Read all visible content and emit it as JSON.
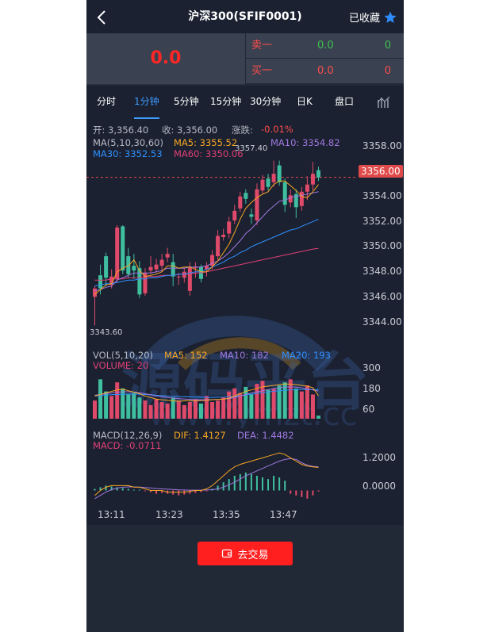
{
  "header": {
    "title": "沪深300(SFIF0001)",
    "favorite_label": "已收藏"
  },
  "quote": {
    "price": "0.0",
    "sell": {
      "label": "卖一",
      "price": "0.0",
      "qty": "0"
    },
    "buy": {
      "label": "买一",
      "price": "0.0",
      "qty": "0"
    }
  },
  "tabs": [
    "分时",
    "1分钟",
    "5分钟",
    "15分钟",
    "30分钟",
    "日K",
    "盘口"
  ],
  "active_tab": "1分钟",
  "stats": {
    "open": "开: 3,356.40",
    "close": "收: 3,356.00",
    "change_label": "涨跌:",
    "change_value": "-0.01%"
  },
  "ma_legend": {
    "params": "MA(5,10,30,60)",
    "ma5": "MA5: 3355.52",
    "ma10": "MA10: 3354.82",
    "ma30": "MA30: 3352.53",
    "ma60": "MA60: 3350.06"
  },
  "vol_legend": {
    "params": "VOL(5,10,20)",
    "ma5": "MA5: 152",
    "ma10": "MA10: 182",
    "ma20": "MA20: 193",
    "volume": "VOLUME: 20"
  },
  "macd_legend": {
    "params": "MACD(12,26,9)",
    "dif": "DIF: 1.4127",
    "dea": "DEA: 1.4482",
    "macd": "MACD: -0.0711"
  },
  "annotations": {
    "high": "3357.40",
    "low": "3343.60",
    "last": "3356.00"
  },
  "watermark": {
    "text": "源码平台",
    "url": "www.ymzt.cc"
  },
  "trade_button": "去交易",
  "colors": {
    "up": "#e04a6a",
    "down": "#3fbfa0",
    "accent": "#3d9bff",
    "price_red": "#ff2626",
    "ma5": "#f5a623",
    "ma10": "#a078e0",
    "ma30": "#2f90ff",
    "ma60": "#e04076"
  },
  "chart_data": [
    {
      "type": "candlestick",
      "title": "",
      "y_ticks": [
        3358.0,
        3356.0,
        3354.0,
        3352.0,
        3350.0,
        3348.0,
        3346.0,
        3344.0
      ],
      "ylim": [
        3343.5,
        3358.7
      ],
      "x_ticks": [
        "13:11",
        "13:23",
        "13:35",
        "13:47"
      ],
      "candles": [
        {
          "o": 3346.0,
          "c": 3346.7,
          "h": 3346.9,
          "l": 3343.6
        },
        {
          "o": 3347.8,
          "c": 3346.7,
          "h": 3348.7,
          "l": 3346.2
        },
        {
          "o": 3349.4,
          "c": 3347.6,
          "h": 3349.7,
          "l": 3346.9
        },
        {
          "o": 3347.0,
          "c": 3347.7,
          "h": 3348.3,
          "l": 3346.7
        },
        {
          "o": 3347.5,
          "c": 3351.8,
          "h": 3352.0,
          "l": 3347.2
        },
        {
          "o": 3351.9,
          "c": 3348.2,
          "h": 3352.0,
          "l": 3347.9
        },
        {
          "o": 3349.4,
          "c": 3347.9,
          "h": 3350.1,
          "l": 3347.6
        },
        {
          "o": 3348.6,
          "c": 3348.2,
          "h": 3349.6,
          "l": 3347.5
        },
        {
          "o": 3348.4,
          "c": 3346.2,
          "h": 3349.0,
          "l": 3345.9
        },
        {
          "o": 3346.3,
          "c": 3348.0,
          "h": 3348.4,
          "l": 3346.1
        },
        {
          "o": 3348.2,
          "c": 3348.5,
          "h": 3349.4,
          "l": 3347.9
        },
        {
          "o": 3348.3,
          "c": 3348.7,
          "h": 3349.2,
          "l": 3348.0
        },
        {
          "o": 3348.6,
          "c": 3349.1,
          "h": 3349.6,
          "l": 3348.1
        },
        {
          "o": 3349.3,
          "c": 3349.6,
          "h": 3350.1,
          "l": 3348.9
        },
        {
          "o": 3348.9,
          "c": 3347.7,
          "h": 3349.6,
          "l": 3346.9
        },
        {
          "o": 3347.7,
          "c": 3347.7,
          "h": 3348.0,
          "l": 3347.0
        },
        {
          "o": 3347.6,
          "c": 3348.1,
          "h": 3348.4,
          "l": 3347.2
        },
        {
          "o": 3346.5,
          "c": 3348.5,
          "h": 3348.9,
          "l": 3346.1
        },
        {
          "o": 3348.4,
          "c": 3348.5,
          "h": 3348.9,
          "l": 3347.6
        },
        {
          "o": 3348.5,
          "c": 3347.5,
          "h": 3348.7,
          "l": 3347.2
        },
        {
          "o": 3348.3,
          "c": 3348.6,
          "h": 3348.9,
          "l": 3347.7
        },
        {
          "o": 3348.6,
          "c": 3349.5,
          "h": 3349.9,
          "l": 3348.3
        },
        {
          "o": 3349.4,
          "c": 3351.1,
          "h": 3351.6,
          "l": 3349.1
        },
        {
          "o": 3351.0,
          "c": 3351.2,
          "h": 3351.7,
          "l": 3350.7
        },
        {
          "o": 3351.3,
          "c": 3352.3,
          "h": 3352.7,
          "l": 3350.9
        },
        {
          "o": 3352.4,
          "c": 3353.2,
          "h": 3353.7,
          "l": 3352.1
        },
        {
          "o": 3353.4,
          "c": 3354.4,
          "h": 3354.8,
          "l": 3353.1
        },
        {
          "o": 3354.7,
          "c": 3354.2,
          "h": 3355.0,
          "l": 3353.8
        },
        {
          "o": 3352.9,
          "c": 3352.7,
          "h": 3353.4,
          "l": 3352.1
        },
        {
          "o": 3352.4,
          "c": 3355.0,
          "h": 3355.5,
          "l": 3352.0
        },
        {
          "o": 3354.9,
          "c": 3355.8,
          "h": 3356.2,
          "l": 3354.6
        },
        {
          "o": 3355.9,
          "c": 3355.2,
          "h": 3356.3,
          "l": 3354.9
        },
        {
          "o": 3355.6,
          "c": 3356.3,
          "h": 3357.4,
          "l": 3355.2
        },
        {
          "o": 3357.0,
          "c": 3355.6,
          "h": 3357.4,
          "l": 3355.3
        },
        {
          "o": 3355.6,
          "c": 3353.7,
          "h": 3355.9,
          "l": 3353.1
        },
        {
          "o": 3353.9,
          "c": 3354.5,
          "h": 3355.0,
          "l": 3353.5
        },
        {
          "o": 3354.6,
          "c": 3353.5,
          "h": 3355.0,
          "l": 3352.6
        },
        {
          "o": 3353.6,
          "c": 3354.8,
          "h": 3355.2,
          "l": 3353.2
        },
        {
          "o": 3354.8,
          "c": 3355.4,
          "h": 3356.1,
          "l": 3354.1
        },
        {
          "o": 3355.4,
          "c": 3356.3,
          "h": 3357.3,
          "l": 3354.9
        },
        {
          "o": 3356.6,
          "c": 3356.0,
          "h": 3356.9,
          "l": 3355.7
        }
      ],
      "ma5": [
        3346.2,
        3346.6,
        3347.0,
        3347.1,
        3348.1,
        3348.4,
        3348.6,
        3349.1,
        3348.2,
        3347.7,
        3347.8,
        3347.9,
        3348.1,
        3348.6,
        3348.6,
        3348.4,
        3348.5,
        3348.5,
        3348.3,
        3348.1,
        3348.1,
        3348.5,
        3349.0,
        3349.7,
        3350.4,
        3351.4,
        3352.5,
        3353.4,
        3353.9,
        3354.3,
        3354.6,
        3354.8,
        3355.4,
        3355.7,
        3355.7,
        3355.3,
        3354.9,
        3354.4,
        3354.3,
        3354.8,
        3355.4
      ],
      "ma10": [
        3346.5,
        3346.6,
        3346.8,
        3346.9,
        3347.4,
        3347.6,
        3347.8,
        3348.0,
        3348.0,
        3348.0,
        3348.0,
        3348.1,
        3348.2,
        3348.4,
        3348.4,
        3348.4,
        3348.4,
        3348.5,
        3348.5,
        3348.5,
        3348.6,
        3348.8,
        3349.0,
        3349.3,
        3349.7,
        3350.2,
        3350.7,
        3351.3,
        3351.7,
        3352.2,
        3352.7,
        3353.2,
        3353.6,
        3354.0,
        3354.1,
        3354.3,
        3354.4,
        3354.5,
        3354.6,
        3354.7,
        3354.8
      ],
      "ma30": [
        3346.9,
        3347.0,
        3347.1,
        3347.1,
        3347.2,
        3347.3,
        3347.4,
        3347.4,
        3347.5,
        3347.5,
        3347.6,
        3347.6,
        3347.7,
        3347.8,
        3347.8,
        3347.9,
        3347.9,
        3348.0,
        3348.1,
        3348.1,
        3348.3,
        3348.5,
        3348.7,
        3348.9,
        3349.2,
        3349.4,
        3349.7,
        3349.9,
        3350.2,
        3350.4,
        3350.6,
        3350.8,
        3351.0,
        3351.2,
        3351.4,
        3351.6,
        3351.7,
        3351.9,
        3352.1,
        3352.3,
        3352.5
      ],
      "ma60": [
        3347.4,
        3347.4,
        3347.4,
        3347.5,
        3347.5,
        3347.5,
        3347.6,
        3347.6,
        3347.6,
        3347.7,
        3347.7,
        3347.7,
        3347.8,
        3347.8,
        3347.8,
        3347.9,
        3347.9,
        3347.9,
        3348.0,
        3348.0,
        3348.1,
        3348.2,
        3348.3,
        3348.4,
        3348.5,
        3348.6,
        3348.7,
        3348.8,
        3348.9,
        3349.0,
        3349.1,
        3349.2,
        3349.3,
        3349.4,
        3349.5,
        3349.6,
        3349.7,
        3349.8,
        3349.9,
        3350.0,
        3350.06
      ]
    },
    {
      "type": "bar",
      "title": "VOL(5,10,20)",
      "y_ticks": [
        300,
        180,
        60
      ],
      "ylim": [
        0,
        330
      ],
      "values": [
        120,
        260,
        180,
        150,
        240,
        200,
        160,
        170,
        140,
        120,
        90,
        130,
        110,
        100,
        140,
        120,
        90,
        110,
        130,
        100,
        150,
        110,
        120,
        140,
        180,
        200,
        170,
        210,
        160,
        230,
        250,
        190,
        200,
        220,
        240,
        260,
        200,
        180,
        220,
        160,
        20
      ],
      "ma5": [
        150,
        160,
        170,
        180,
        190,
        195,
        185,
        175,
        165,
        150,
        140,
        130,
        125,
        122,
        118,
        115,
        118,
        120,
        118,
        120,
        122,
        125,
        128,
        130,
        135,
        150,
        165,
        180,
        190,
        200,
        210,
        215,
        220,
        225,
        230,
        228,
        225,
        220,
        215,
        205,
        152
      ],
      "ma10": [
        155,
        160,
        165,
        170,
        175,
        178,
        178,
        176,
        172,
        165,
        158,
        150,
        145,
        140,
        136,
        132,
        130,
        128,
        126,
        125,
        125,
        126,
        128,
        130,
        133,
        140,
        150,
        160,
        170,
        178,
        185,
        192,
        198,
        204,
        208,
        210,
        208,
        204,
        198,
        190,
        182
      ],
      "ma20": [
        150,
        152,
        155,
        158,
        160,
        162,
        163,
        163,
        162,
        160,
        158,
        155,
        152,
        150,
        148,
        146,
        145,
        144,
        143,
        142,
        141,
        141,
        142,
        143,
        145,
        148,
        152,
        157,
        162,
        167,
        172,
        177,
        181,
        185,
        188,
        190,
        192,
        193,
        193,
        193,
        193
      ]
    },
    {
      "type": "bar",
      "title": "MACD(12,26,9)",
      "y_ticks": [
        1.2,
        0.0
      ],
      "ylim": [
        -0.8,
        2.6
      ],
      "values": [
        0.1,
        0.2,
        0.3,
        0.25,
        0.2,
        0.15,
        0.1,
        0.05,
        0.05,
        -0.05,
        -0.1,
        -0.2,
        -0.15,
        -0.2,
        -0.25,
        -0.3,
        -0.25,
        -0.2,
        -0.15,
        -0.1,
        -0.05,
        0.1,
        0.3,
        0.5,
        0.7,
        0.9,
        1.0,
        1.1,
        1.0,
        0.9,
        0.8,
        0.7,
        0.9,
        0.8,
        0.6,
        -0.2,
        -0.3,
        -0.4,
        -0.5,
        -0.3,
        -0.07
      ],
      "dif": [
        -0.3,
        0.0,
        0.2,
        0.3,
        0.3,
        0.3,
        0.3,
        0.2,
        0.2,
        0.1,
        0.0,
        0.0,
        0.0,
        -0.1,
        -0.1,
        -0.1,
        -0.1,
        -0.05,
        0.0,
        0.0,
        0.1,
        0.3,
        0.6,
        0.9,
        1.2,
        1.45,
        1.6,
        1.7,
        1.8,
        1.9,
        2.0,
        2.1,
        2.2,
        2.3,
        2.2,
        2.0,
        1.8,
        1.6,
        1.5,
        1.45,
        1.41
      ],
      "dea": [
        -0.5,
        -0.3,
        -0.1,
        0.05,
        0.15,
        0.2,
        0.22,
        0.22,
        0.21,
        0.18,
        0.15,
        0.12,
        0.1,
        0.08,
        0.06,
        0.04,
        0.03,
        0.02,
        0.02,
        0.02,
        0.03,
        0.05,
        0.1,
        0.2,
        0.35,
        0.5,
        0.7,
        0.9,
        1.05,
        1.2,
        1.35,
        1.5,
        1.65,
        1.8,
        1.9,
        1.95,
        1.9,
        1.7,
        1.55,
        1.48,
        1.45
      ]
    }
  ]
}
